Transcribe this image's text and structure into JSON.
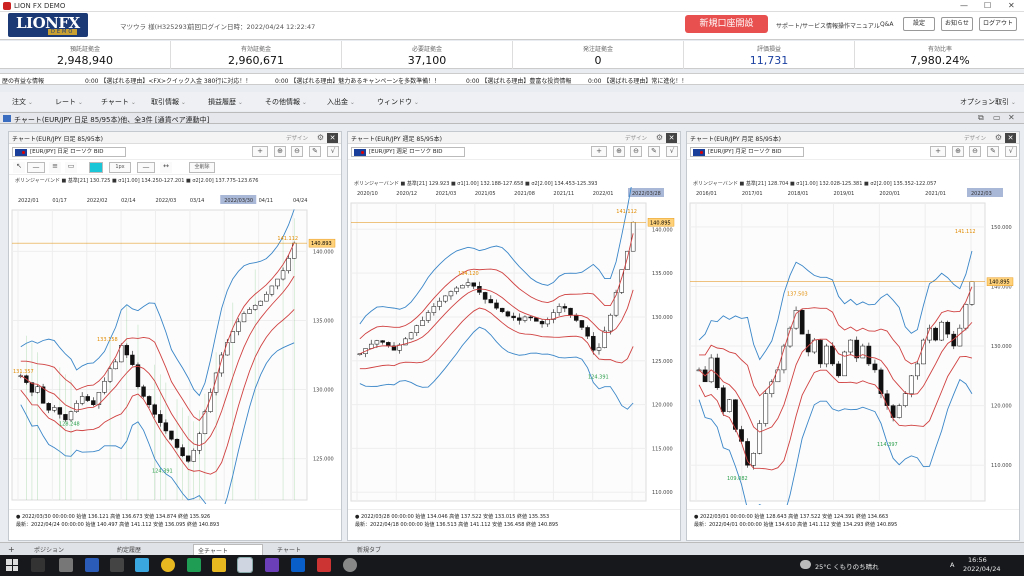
{
  "window": {
    "title": "LION FX DEMO",
    "controls": [
      "—",
      "☐",
      "✕"
    ]
  },
  "header": {
    "logo_main": "LIONFX",
    "logo_sub": "DEMO",
    "account": "マツウラ 様(H325293)",
    "last_login": "前回ログイン日時：2022/04/24 12:22:47",
    "open_account": "新規口座開設",
    "links": [
      "サポート/サービス情報",
      "操作マニュアル",
      "Q&A"
    ],
    "buttons": [
      "設定",
      "お知らせ",
      "ログアウト"
    ]
  },
  "summary": [
    {
      "label": "預託証拠金",
      "value": "2,948,940",
      "color": "#111"
    },
    {
      "label": "有効証拠金",
      "value": "2,960,671",
      "color": "#111"
    },
    {
      "label": "必要証拠金",
      "value": "37,100",
      "color": "#111"
    },
    {
      "label": "発注証拠金",
      "value": "0",
      "color": "#111"
    },
    {
      "label": "評価損益",
      "value": "11,731",
      "color": "#1a3fa0"
    },
    {
      "label": "有効比率",
      "value": "7,980.24%",
      "color": "#111"
    }
  ],
  "ticker": [
    "歴の有益な情報",
    "0:00 【選ばれる理由】<FX>クイック入金 380行に対応！！",
    "0:00 【選ばれる理由】魅力あるキャンペーンを多数準備！！",
    "0:00 【選ばれる理由】豊富な投資情報",
    "0:00 【選ばれる理由】常に進化！！"
  ],
  "menu": [
    "注文",
    "レート",
    "チャート",
    "取引情報",
    "損益履歴",
    "その他情報",
    "入出金",
    "ウィンドウ"
  ],
  "menu_right": "オプション取引",
  "window_title": "チャート(EUR/JPY 日足 85/95本)他、全3件 [通貨ペア連動中]",
  "panels": [
    {
      "title": "チャート(EUR/JPY 日足 85/95本)",
      "symbol": "[EUR/JPY] 日足 ローソク BID",
      "legend": "ボリンジャーバンド ■ 基準[21] 130.725 ■ σ1[1.00] 134.250-127.201 ■ σ2[2.00] 137.775-123.676",
      "dates": [
        "2022/01",
        "01/17",
        "2022/02",
        "02/14",
        "2022/03",
        "03/14",
        "2022/03/30",
        "04/11",
        "04/24"
      ],
      "yticks": [
        "140.000",
        "135.000",
        "130.000",
        "125.000"
      ],
      "ymin": 122,
      "ymax": 143,
      "price_tag": "140.893",
      "labels": {
        "high": "141.112",
        "mid": "133.158",
        "left": "131.357",
        "low1": "128.248",
        "low2": "124.391"
      },
      "footer1": "● 2022/03/30 00:00:00 始値 136.121 高値 136.673 安値 134.874 終値 135.926",
      "footer2": "最新：2022/04/24 00:00:00 始値 140.497 高値 141.112 安値 136.095 終値 140.893",
      "draw_tools": [
        "1px",
        "全削除"
      ]
    },
    {
      "title": "チャート(EUR/JPY 週足 85/95本)",
      "symbol": "[EUR/JPY] 週足 ローソク BID",
      "legend": "ボリンジャーバンド ■ 基準[21] 129.923 ■ σ1[1.00] 132.188-127.658 ■ σ2[2.00] 134.453-125.393",
      "dates": [
        "2020/10",
        "2020/12",
        "2021/03",
        "2021/05",
        "2021/08",
        "2021/11",
        "2022/01",
        "2022/03/28"
      ],
      "yticks": [
        "140.000",
        "135.000",
        "130.000",
        "125.000",
        "120.000",
        "115.000",
        "110.000"
      ],
      "ymin": 109,
      "ymax": 143,
      "price_tag": "140.895",
      "labels": {
        "high": "141.112",
        "mid": "134.120",
        "low2": "124.391"
      },
      "footer1": "● 2022/03/28 00:00:00 始値 134.046 高値 137.522 安値 133.015 終値 135.353",
      "footer2": "最新：2022/04/18 00:00:00 始値 136.513 高値 141.112 安値 136.458 終値 140.895"
    },
    {
      "title": "チャート(EUR/JPY 月足 85/95本)",
      "symbol": "[EUR/JPY] 月足 ローソク BID",
      "legend": "ボリンジャーバンド ■ 基準[21] 128.704 ■ σ1[1.00] 132.028-125.381 ■ σ2[2.00] 135.352-122.057",
      "dates": [
        "2016/01",
        "2017/01",
        "2018/01",
        "2019/01",
        "2020/01",
        "2021/01",
        "2022/03"
      ],
      "yticks": [
        "150.000",
        "140.000",
        "130.000",
        "120.000",
        "110.000"
      ],
      "ymin": 104,
      "ymax": 154,
      "price_tag": "140.895",
      "labels": {
        "high": "141.112",
        "mid": "137.503",
        "low1": "114.397",
        "low2": "109.082"
      },
      "footer1": "● 2022/03/01 00:00:00 始値 128.643 高値 137.522 安値 124.391 終値 134.663",
      "footer2": "最新：2022/04/01 00:00:00 始値 134.610 高値 141.112 安値 134.293 終値 140.895"
    }
  ],
  "tabs": [
    "ポジション",
    "約定履歴",
    "全チャート",
    "チャート",
    "新規タブ"
  ],
  "taskbar": {
    "weather": "25°C くもりのち晴れ",
    "time": "16:56",
    "date": "2022/04/24",
    "ime": "A"
  },
  "colors": {
    "up": "#ffffff",
    "down": "#111111",
    "sigma1": "#d04040",
    "sigma2": "#3a86c8",
    "mid": "#d04040",
    "vline": "#4caf50",
    "price": "#e08a00"
  }
}
